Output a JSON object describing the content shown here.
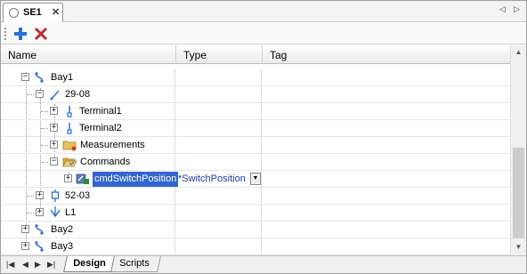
{
  "doc_tab": {
    "title": "SE1",
    "close_glyph": "✕"
  },
  "toolbar": {
    "add_icon": "plus-icon",
    "delete_icon": "delete-x-icon"
  },
  "grid": {
    "columns": [
      "Name",
      "Type",
      "Tag"
    ],
    "rows": [
      {
        "label": "Bay1",
        "icon": "bay-icon",
        "expander": "−",
        "type": "",
        "tag": ""
      },
      {
        "label": "29-08",
        "icon": "switch-icon",
        "expander": "−",
        "type": "",
        "tag": ""
      },
      {
        "label": "Terminal1",
        "icon": "terminal-icon",
        "expander": "+",
        "type": "",
        "tag": ""
      },
      {
        "label": "Terminal2",
        "icon": "terminal-icon",
        "expander": "+",
        "type": "",
        "tag": ""
      },
      {
        "label": "Measurements",
        "icon": "folder-icon",
        "expander": "+",
        "type": "",
        "tag": ""
      },
      {
        "label": "Commands",
        "icon": "folder-open-icon",
        "expander": "−",
        "type": "",
        "tag": ""
      },
      {
        "label": "cmdSwitchPosition",
        "icon": "command-icon",
        "expander": "+",
        "type": "*SwitchPosition",
        "tag": ""
      },
      {
        "label": "52-03",
        "icon": "breaker-icon",
        "expander": "+",
        "type": "",
        "tag": ""
      },
      {
        "label": "L1",
        "icon": "line-icon",
        "expander": "+",
        "type": "",
        "tag": ""
      },
      {
        "label": "Bay2",
        "icon": "bay-icon",
        "expander": "+",
        "type": "",
        "tag": ""
      },
      {
        "label": "Bay3",
        "icon": "bay-icon",
        "expander": "+",
        "type": "",
        "tag": ""
      }
    ]
  },
  "bottom_tabs": {
    "active": "Design",
    "inactive": "Scripts"
  },
  "colors": {
    "selection": "#3366cc",
    "type_text": "#1a3aa8",
    "icon_blue": "#2b6fd6",
    "folder": "#e8c35a",
    "delete_red": "#c0282d"
  }
}
